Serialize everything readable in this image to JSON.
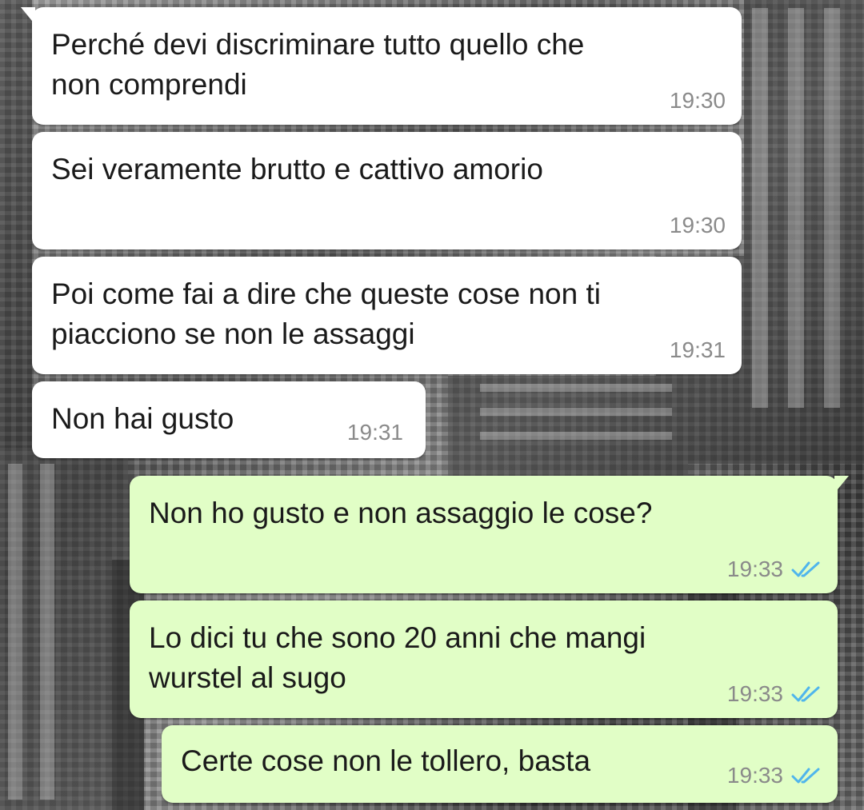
{
  "theme": {
    "incoming_bubble_color": "#ffffff",
    "outgoing_bubble_color": "#e1fec6",
    "read_tick_color": "#4fb5ec"
  },
  "messages": [
    {
      "direction": "incoming",
      "text": "Perché devi discriminare tutto quello che\nnon comprendi",
      "time": "19:30"
    },
    {
      "direction": "incoming",
      "text": "Sei veramente brutto e cattivo amorio",
      "time": "19:30"
    },
    {
      "direction": "incoming",
      "text": "Poi come fai a dire che queste cose non ti\npiacciono se non le assaggi",
      "time": "19:31"
    },
    {
      "direction": "incoming",
      "text": "Non hai gusto",
      "time": "19:31"
    },
    {
      "direction": "outgoing",
      "text": "Non ho gusto e non assaggio le cose?",
      "time": "19:33",
      "status_icon": "double-check-read-icon"
    },
    {
      "direction": "outgoing",
      "text": "Lo dici tu che sono 20 anni che mangi\nwurstel al sugo",
      "time": "19:33",
      "status_icon": "double-check-read-icon"
    },
    {
      "direction": "outgoing",
      "text": "Certe cose non le tollero, basta",
      "time": "19:33",
      "status_icon": "double-check-read-icon"
    }
  ]
}
